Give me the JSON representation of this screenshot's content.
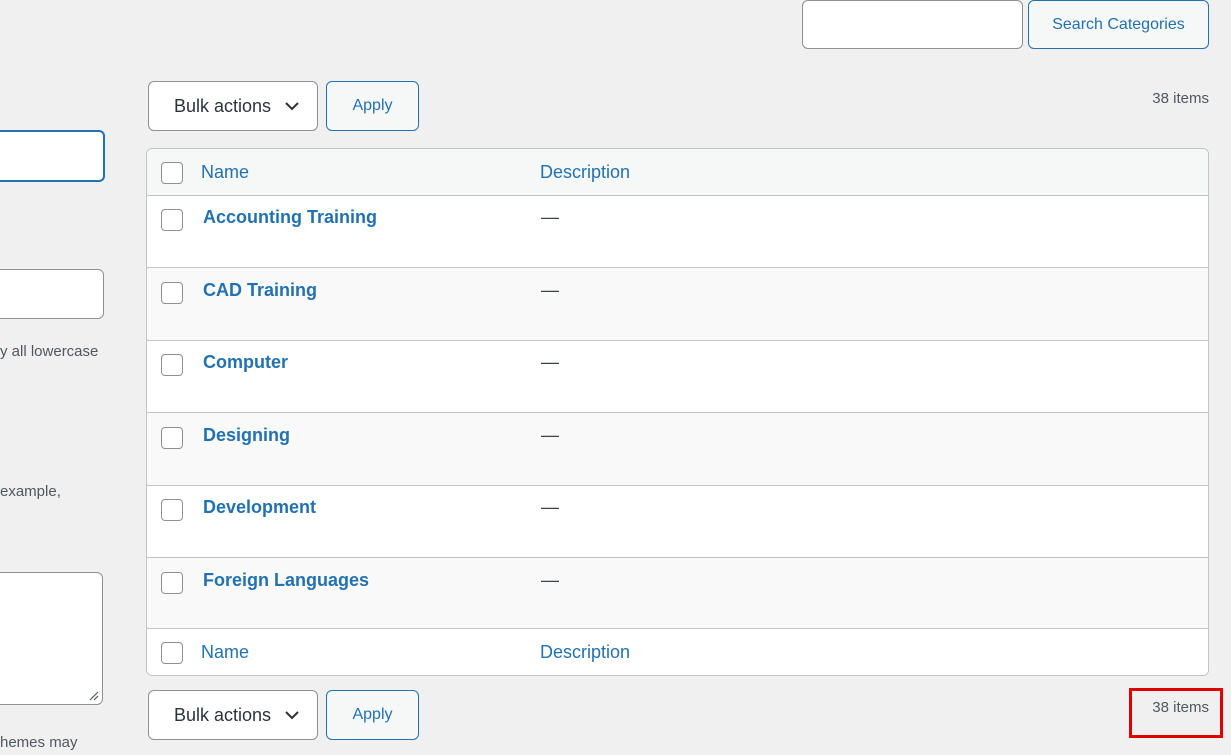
{
  "search": {
    "value": "",
    "button_label": "Search Categories"
  },
  "top_nav": {
    "bulk_actions_label": "Bulk actions",
    "apply_label": "Apply",
    "items_count": "38 items"
  },
  "bottom_nav": {
    "bulk_actions_label": "Bulk actions",
    "apply_label": "Apply",
    "items_count": "38 items"
  },
  "left_form": {
    "slug_help": "y all lowercase",
    "parent_help": "example,",
    "desc_help": "hemes may"
  },
  "table": {
    "columns": [
      "Name",
      "Description"
    ],
    "rows": [
      {
        "name": "Accounting Training",
        "description": "—"
      },
      {
        "name": "CAD Training",
        "description": "—"
      },
      {
        "name": "Computer",
        "description": "—"
      },
      {
        "name": "Designing",
        "description": "—"
      },
      {
        "name": "Development",
        "description": "—"
      },
      {
        "name": "Foreign Languages",
        "description": "—"
      }
    ]
  },
  "colors": {
    "accent": "#2271b1",
    "highlight": "#e00000",
    "background": "#f0f0f1"
  },
  "icons": {
    "dropdown": "chevron-down-icon",
    "resize": "resize-handle-icon"
  }
}
